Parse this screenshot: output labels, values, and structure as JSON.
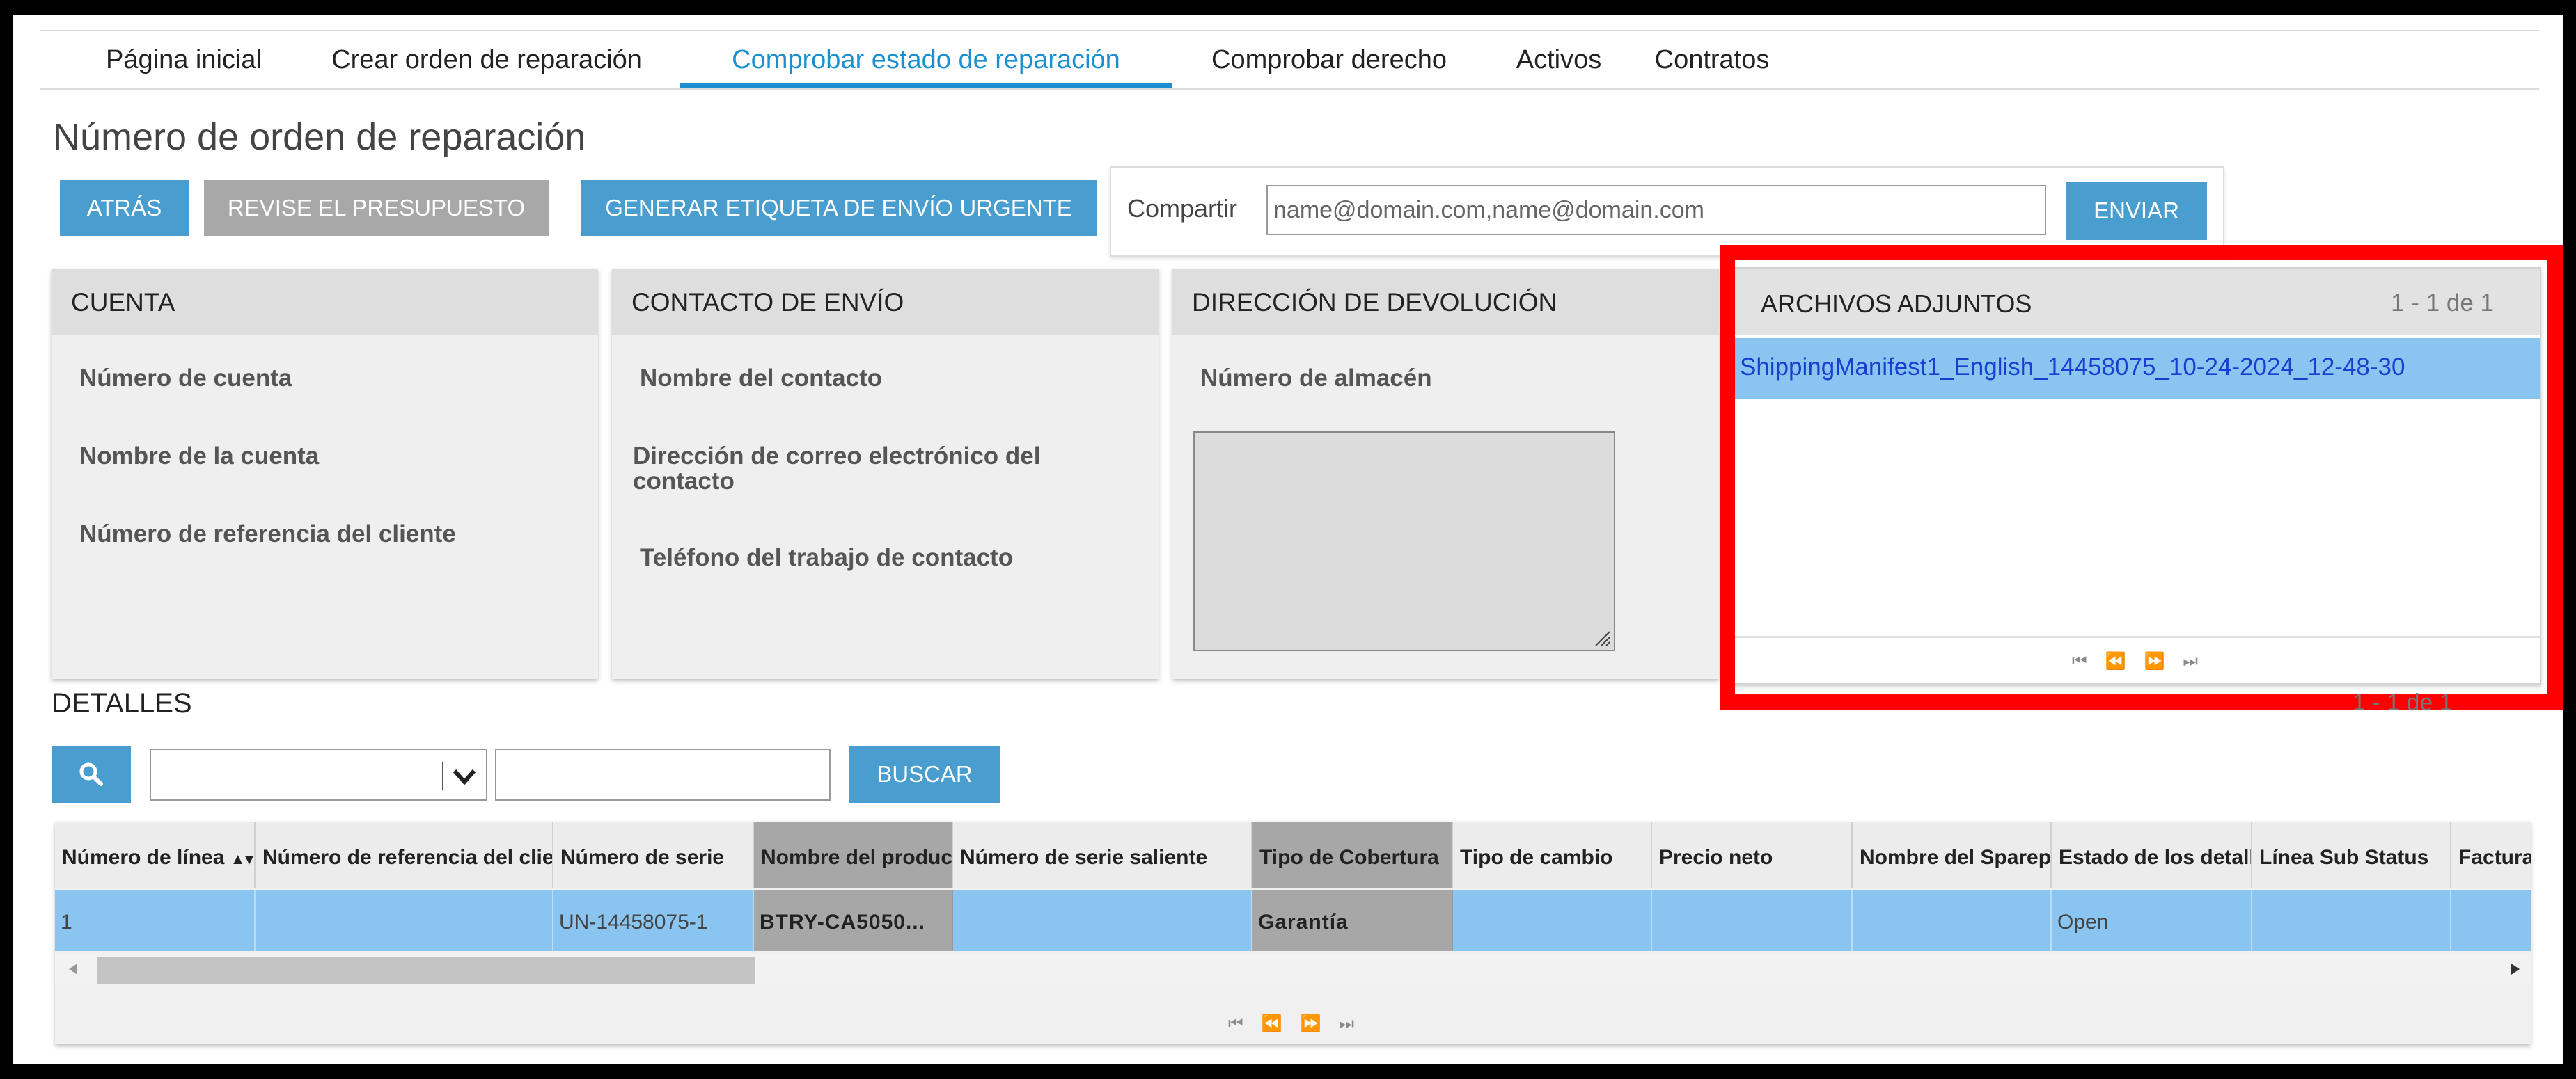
{
  "nav": {
    "items": [
      {
        "label": "Página inicial",
        "active": false
      },
      {
        "label": "Crear orden de reparación",
        "active": false
      },
      {
        "label": "Comprobar estado de reparación",
        "active": true
      },
      {
        "label": "Comprobar derecho",
        "active": false
      },
      {
        "label": "Activos",
        "active": false
      },
      {
        "label": "Contratos",
        "active": false
      }
    ],
    "active_color": "#1b8fd0"
  },
  "page_title": "Número de orden de reparación",
  "toolbar": {
    "back_label": "ATRÁS",
    "review_quote_label": "REVISE EL PRESUPUESTO",
    "urgent_label_label": "GENERAR ETIQUETA DE ENVÍO URGENTE"
  },
  "share": {
    "label": "Compartir",
    "input_value": "",
    "input_placeholder": "name@domain.com,name@domain.com",
    "send_label": "ENVIAR"
  },
  "panels": {
    "account": {
      "title": "CUENTA",
      "fields": [
        "Número de cuenta",
        "Nombre de la cuenta",
        "Número de referencia del cliente"
      ]
    },
    "shipping_contact": {
      "title": "CONTACTO DE ENVÍO",
      "fields": [
        "Nombre del contacto",
        "Dirección de correo electrónico del contacto",
        "Teléfono del trabajo de contacto"
      ]
    },
    "return_address": {
      "title": "DIRECCIÓN DE DEVOLUCIÓN",
      "fields": [
        "Número de almacén"
      ]
    }
  },
  "attachments": {
    "title": "ARCHIVOS ADJUNTOS",
    "count": "1 - 1 de 1",
    "files": [
      "ShippingManifest1_English_14458075_10-24-2024_12-48-30"
    ],
    "pager": "⏮⏪⏩⏭"
  },
  "details": {
    "title": "DETALLES",
    "count": "1 - 1 de 1",
    "search_label": "BUSCAR",
    "filter_value": "",
    "search_value": "",
    "columns": [
      "Número de línea",
      "Número de referencia del cliente",
      "Número de serie",
      "Nombre del producto",
      "Número de serie saliente",
      "Tipo de Cobertura",
      "Tipo de cambio",
      "Precio neto",
      "Nombre del Sparepart",
      "Estado de los detalles",
      "Línea Sub Status",
      "Factura"
    ],
    "rows": [
      [
        "1",
        "",
        "UN-14458075-1",
        "BTRY-CA5050...",
        "",
        "Garantía",
        "",
        "",
        "",
        "Open",
        "",
        ""
      ]
    ],
    "pager": "⏮⏪⏩⏭"
  },
  "highlight_color": "#ff0000",
  "selected_row_color": "#8ac4f0"
}
